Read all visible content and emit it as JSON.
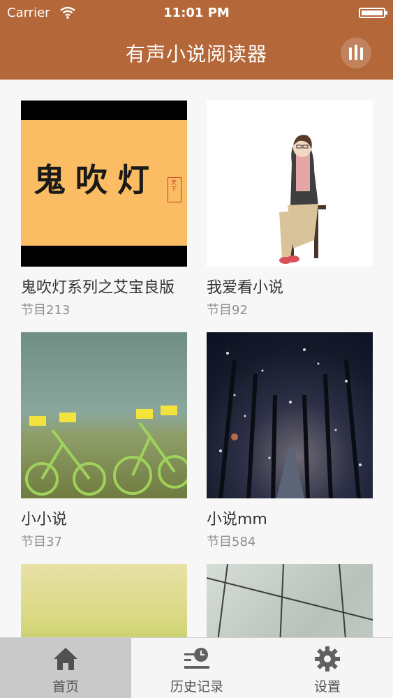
{
  "status_bar": {
    "carrier": "Carrier",
    "time": "11:01 PM"
  },
  "nav": {
    "title": "有声小说阅读器"
  },
  "books": [
    {
      "title": "鬼吹灯系列之艾宝良版",
      "count": "节目213",
      "cover_text": "鬼吹灯",
      "seal_text": "天下"
    },
    {
      "title": "我爱看小说",
      "count": "节目92"
    },
    {
      "title": "小小说",
      "count": "节目37"
    },
    {
      "title": "小说mm",
      "count": "节目584"
    },
    {
      "title": "",
      "count": ""
    },
    {
      "title": "",
      "count": ""
    }
  ],
  "tabs": [
    {
      "label": "首页",
      "icon": "home-icon"
    },
    {
      "label": "历史记录",
      "icon": "history-icon"
    },
    {
      "label": "设置",
      "icon": "gear-icon"
    }
  ],
  "colors": {
    "accent": "#b4683a",
    "tab_active_bg": "#c9c9c9"
  }
}
